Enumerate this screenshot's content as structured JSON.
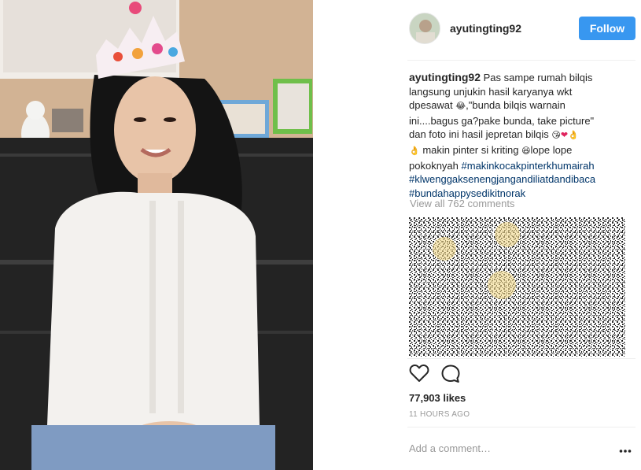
{
  "post": {
    "username": "ayutingting92",
    "follow_label": "Follow",
    "caption_lines": [
      "Pas sampe rumah bilqis",
      "langsung unjukin hasil karyanya wkt",
      "dpesawat",
      ",\"bunda bilqis warnain",
      "ini....bagus ga?pake bunda, take picture\"",
      "dan foto ini hasil jepretan bilqis",
      "makin pinter si kriting",
      "lope lope",
      "pokoknyah"
    ],
    "hashtags": [
      "#makinkocakpinterkhumairah",
      "#klwenggaksenengjangandiliatdandibaca",
      "#bundahappysedikitnorak"
    ],
    "emojis": {
      "laugh": "😂",
      "kiss": "😘",
      "heart": "❤",
      "hand": "👌",
      "grin": "😆"
    },
    "view_comments": "View all 762 comments",
    "likes": "77,903 likes",
    "time": "11 HOURS AGO",
    "comment_placeholder": "Add a comment…",
    "icons": {
      "like": "heart-icon",
      "comment": "speech-bubble-icon",
      "more": "more-options-icon"
    }
  },
  "colors": {
    "follow_bg": "#3897f0",
    "hashtag": "#003569",
    "muted": "#999999"
  }
}
